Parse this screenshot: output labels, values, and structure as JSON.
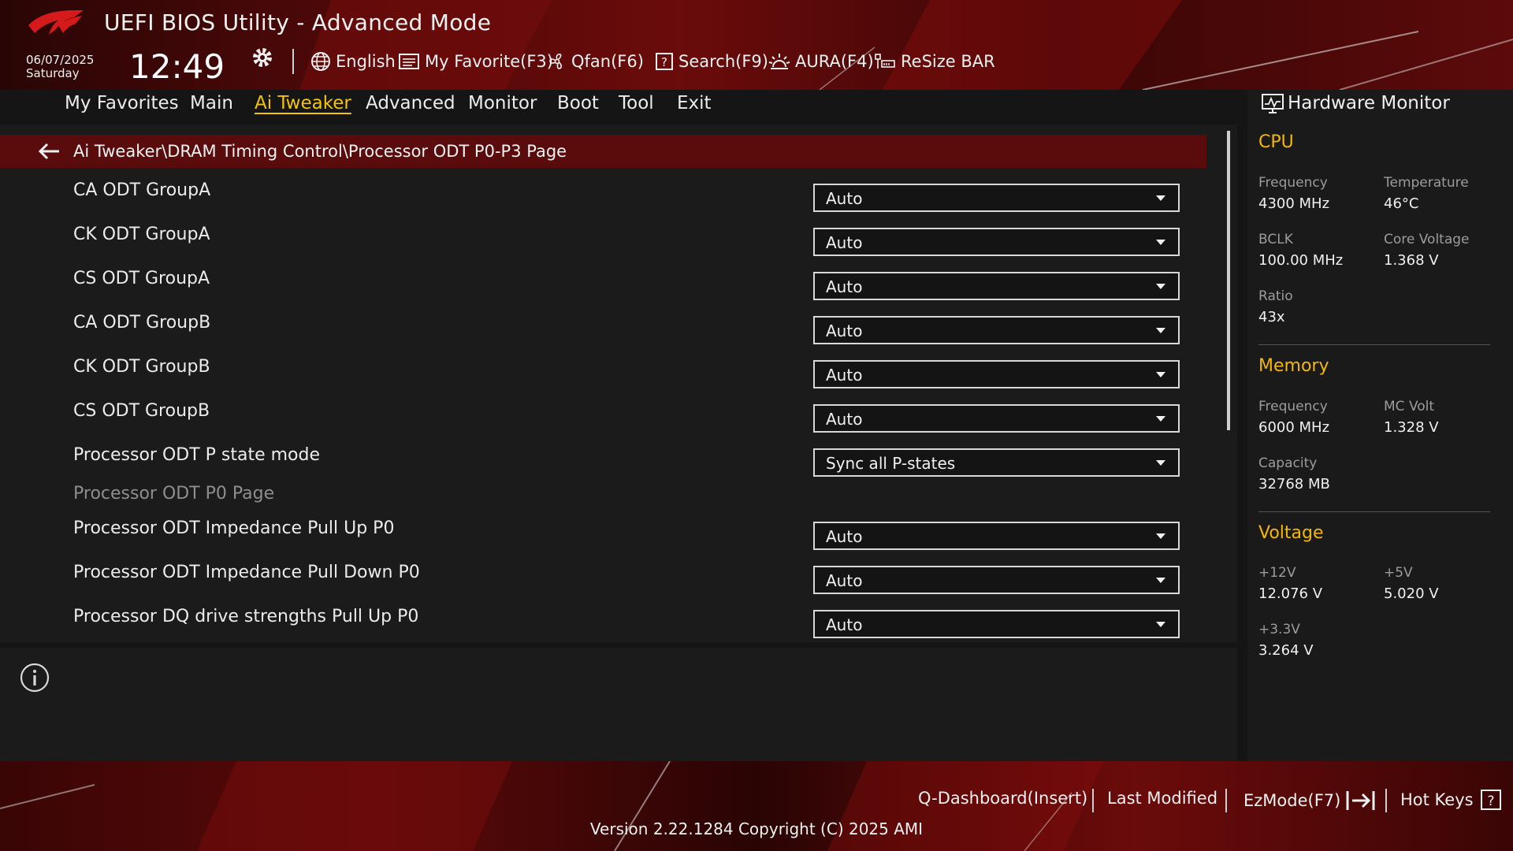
{
  "header": {
    "title": "UEFI BIOS Utility - Advanced Mode",
    "date": "06/07/2025",
    "day": "Saturday",
    "time": "12:49",
    "toolbar": [
      {
        "label": "English",
        "icon": "globe-icon"
      },
      {
        "label": "My Favorite(F3)",
        "icon": "favorite-list-icon"
      },
      {
        "label": "Qfan(F6)",
        "icon": "fan-icon"
      },
      {
        "label": "Search(F9)",
        "icon": "search-question-icon"
      },
      {
        "label": "AURA(F4)",
        "icon": "aura-light-icon"
      },
      {
        "label": "ReSize BAR",
        "icon": "resize-bar-icon"
      }
    ]
  },
  "menu": {
    "tabs": [
      "My Favorites",
      "Main",
      "Ai Tweaker",
      "Advanced",
      "Monitor",
      "Boot",
      "Tool",
      "Exit"
    ],
    "active": "Ai Tweaker"
  },
  "breadcrumb": "Ai Tweaker\\DRAM Timing Control\\Processor ODT P0-P3 Page",
  "settings": [
    {
      "label": "CA ODT GroupA",
      "value": "Auto"
    },
    {
      "label": "CK ODT GroupA",
      "value": "Auto"
    },
    {
      "label": "CS ODT GroupA",
      "value": "Auto"
    },
    {
      "label": "CA ODT GroupB",
      "value": "Auto"
    },
    {
      "label": "CK ODT GroupB",
      "value": "Auto"
    },
    {
      "label": "CS ODT GroupB",
      "value": "Auto"
    },
    {
      "label": "Processor ODT P state mode",
      "value": "Sync all P-states"
    },
    {
      "label": "Processor ODT P0 Page",
      "value": null
    },
    {
      "label": "Processor ODT Impedance Pull Up P0",
      "value": "Auto"
    },
    {
      "label": "Processor ODT Impedance Pull Down P0",
      "value": "Auto"
    },
    {
      "label": "Processor DQ drive strengths Pull Up P0",
      "value": "Auto"
    }
  ],
  "hardware_monitor": {
    "title": "Hardware Monitor",
    "cpu": {
      "heading": "CPU",
      "frequency_label": "Frequency",
      "frequency": "4300 MHz",
      "temperature_label": "Temperature",
      "temperature": "46°C",
      "bclk_label": "BCLK",
      "bclk": "100.00 MHz",
      "core_voltage_label": "Core Voltage",
      "core_voltage": "1.368 V",
      "ratio_label": "Ratio",
      "ratio": "43x"
    },
    "memory": {
      "heading": "Memory",
      "frequency_label": "Frequency",
      "frequency": "6000 MHz",
      "mc_volt_label": "MC Volt",
      "mc_volt": "1.328 V",
      "capacity_label": "Capacity",
      "capacity": "32768 MB"
    },
    "voltage": {
      "heading": "Voltage",
      "v12_label": "+12V",
      "v12": "12.076 V",
      "v5_label": "+5V",
      "v5": "5.020 V",
      "v33_label": "+3.3V",
      "v33": "3.264 V"
    }
  },
  "footer": {
    "qdashboard": "Q-Dashboard(Insert)",
    "last_modified": "Last Modified",
    "ezmode": "EzMode(F7)",
    "hotkeys": "Hot Keys",
    "version": "Version 2.22.1284 Copyright (C) 2025 AMI"
  },
  "colors": {
    "accent": "#f5c400",
    "brand_red": "#5a0b0b",
    "section_heading": "#f5b800"
  }
}
